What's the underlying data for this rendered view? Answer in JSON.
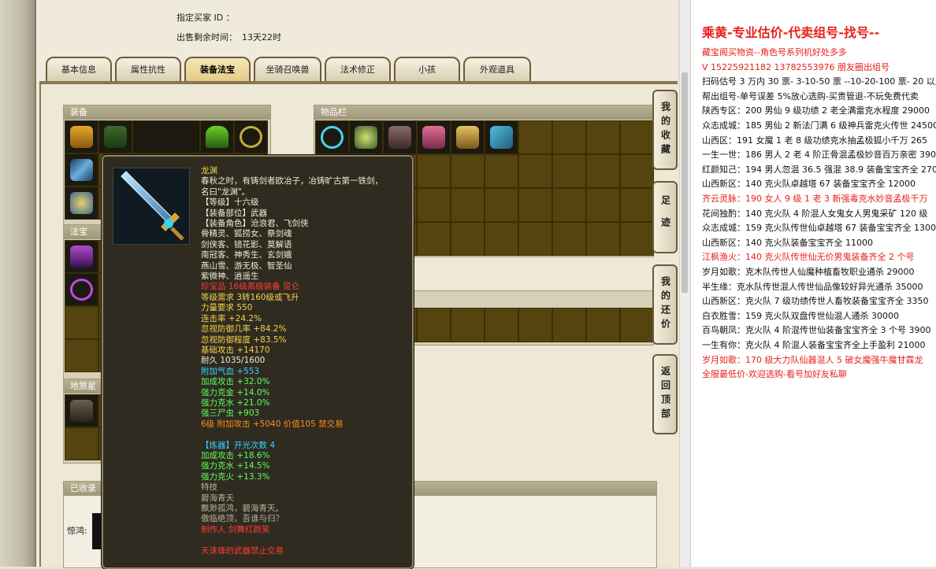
{
  "seller": {
    "seller_id_label": "指定买家 ID ：",
    "remaining_label": "出售剩余时间：",
    "remaining_value": "13天22时"
  },
  "tabs": [
    {
      "label": "基本信息"
    },
    {
      "label": "属性抗性"
    },
    {
      "label": "装备法宝"
    },
    {
      "label": "坐骑召唤兽"
    },
    {
      "label": "法术修正"
    },
    {
      "label": "小孩"
    },
    {
      "label": "外观道具"
    }
  ],
  "panels": {
    "equipment": "装备",
    "inventory": "物品栏",
    "magic": "法宝",
    "collected": "已收录",
    "ground": "地煞星",
    "collected_label": "惊鸿:"
  },
  "nav_buttons": [
    {
      "label": "我的收藏"
    },
    {
      "label": "足迹"
    },
    {
      "label": "我的还价"
    },
    {
      "label": "返回顶部"
    }
  ],
  "tooltip": {
    "name": "龙渊",
    "lines": [
      {
        "text": "春秋之时，有铸剑者欧冶子，冶铸旷古第一铁剑，",
        "color": "white"
      },
      {
        "text": "名曰\"龙渊\"。",
        "color": "white"
      },
      {
        "text": "【等级】十六级",
        "color": "white"
      },
      {
        "text": "【装备部位】武器",
        "color": "white"
      },
      {
        "text": "【装备角色】沧浪君、飞剑侠",
        "color": "white"
      },
      {
        "text": "骨精灵、狐捞女、祭剑魂",
        "color": "white"
      },
      {
        "text": "剑侠客、镜花影、莫解语",
        "color": "white"
      },
      {
        "text": "南冠客、神秀生、玄剑娥",
        "color": "white"
      },
      {
        "text": "燕山雪、游无极、智圣仙",
        "color": "white"
      },
      {
        "text": "紫微神、逍遥生",
        "color": "white"
      },
      {
        "text": "珍宝品 16级高级装备 昆仑",
        "color": "red"
      },
      {
        "text": "等级需求 3转160级或飞升",
        "color": "yellow"
      },
      {
        "text": "力量要求 550",
        "color": "yellow"
      },
      {
        "text": "连击率 +24.2%",
        "color": "yellow"
      },
      {
        "text": "忽视防御几率 +84.2%",
        "color": "yellow"
      },
      {
        "text": "忽视防御程度 +83.5%",
        "color": "yellow"
      },
      {
        "text": "基础攻击 +14170",
        "color": "yellow"
      },
      {
        "text": "耐久 1035/1600",
        "color": "white"
      },
      {
        "text": "附加气血 +553",
        "color": "cyan"
      },
      {
        "text": "加成攻击 +32.0%",
        "color": "green"
      },
      {
        "text": "强力克金 +14.0%",
        "color": "green"
      },
      {
        "text": "强力克水 +21.0%",
        "color": "green"
      },
      {
        "text": "强三尸虫 +903",
        "color": "green"
      },
      {
        "text": "6级 附加攻击 +5040 价值105 禁交易",
        "color": "orange"
      },
      {
        "text": "",
        "color": "white"
      },
      {
        "text": "【炼器】开光次数 4",
        "color": "cyan"
      },
      {
        "text": "加成攻击 +18.6%",
        "color": "green"
      },
      {
        "text": "强力克水 +14.5%",
        "color": "green"
      },
      {
        "text": "强力克火 +13.3%",
        "color": "green"
      },
      {
        "text": "特技",
        "color": "grey"
      },
      {
        "text": "碧海青天",
        "color": "grey"
      },
      {
        "text": "飘渺孤鸿，碧海青天。",
        "color": "grey"
      },
      {
        "text": "傲临绝顶，吾谁与归？",
        "color": "grey"
      },
      {
        "text": "制作人 剑舞红颜笑",
        "color": "red"
      },
      {
        "text": "",
        "color": "white"
      },
      {
        "text": "天诛锋的武器禁止交易",
        "color": "red"
      }
    ]
  },
  "doc": {
    "title": "乘黄-专业估价-代卖组号-找号--",
    "lines": [
      {
        "text": "藏宝阁买物资--角色号系列机好处多多",
        "color": "red"
      },
      {
        "text": "V 15225921182  13782553976 朋友圈出组号",
        "color": "red"
      },
      {
        "text": "扫码估号 3 万内 30 票- 3-10-50 票 --10-20-100 票- 20 以上",
        "color": "black"
      },
      {
        "text": "帮出组号-单号误差 5%放心选购-买贵管退-不玩免费代卖",
        "color": "black"
      },
      {
        "text": "陕西专区：200 男仙 9 级功绩 2 老全满雷克水程度 29000",
        "color": "black"
      },
      {
        "text": "众志成城：185 男仙 2 新法门满 6 级神兵雷克火传世 24500",
        "color": "black"
      },
      {
        "text": "山西区：191 女魔 1 老 8 级功绩克水抽孟极狐小千万 265",
        "color": "black"
      },
      {
        "text": "一生一世：186 男人 2 老 4 阶正骨混孟极妙音百万亲密 390",
        "color": "black"
      },
      {
        "text": "红颜知己：194 男人忽混 36.5 强混 38.9 装备宝宝齐全 2700",
        "color": "black"
      },
      {
        "text": "山西新区：140 克火队卓越塔 67 装备宝宝齐全 12000",
        "color": "black"
      },
      {
        "text": "齐云灵脉：190 女人 9 级 1 老 3 新强毒克水妙音孟极千万",
        "color": "red"
      },
      {
        "text": "花间独酌：140 克火队 4 阶混人女鬼女人男鬼采矿 120 级",
        "color": "black"
      },
      {
        "text": "众志成城：159 克火队传世仙卓越塔 67 装备宝宝齐全 1300",
        "color": "black"
      },
      {
        "text": "山西新区：140 克火队装备宝宝齐全 11000",
        "color": "black"
      },
      {
        "text": "江枫渔火：140 克火队传世仙无价男鬼装备齐全 2 个号",
        "color": "red"
      },
      {
        "text": "岁月如歌：克木队传世人仙魔种植畜牧职业通杀 29000",
        "color": "black"
      },
      {
        "text": "半生缘：克水队传世混人传世仙品像较好异光通杀 35000",
        "color": "black"
      },
      {
        "text": "山西新区：克火队 7 级功绩传世人畜牧装备宝宝齐全 3350",
        "color": "black"
      },
      {
        "text": "白衣胜雪：159 克火队双盘传世仙混人通杀 30000",
        "color": "black"
      },
      {
        "text": "百鸟朝凤：克火队 4 阶混传世仙装备宝宝齐全 3 个号 3900",
        "color": "black"
      },
      {
        "text": "一生有你：克火队 4 阶混人装备宝宝齐全上手盈利 21000",
        "color": "black"
      },
      {
        "text": "岁月如歌：170 级大力队仙器混人 5 破女魔强牛魔甘霖龙",
        "color": "red"
      },
      {
        "text": "全服最低价-欢迎选购-看号加好友私聊",
        "color": "red"
      }
    ]
  }
}
